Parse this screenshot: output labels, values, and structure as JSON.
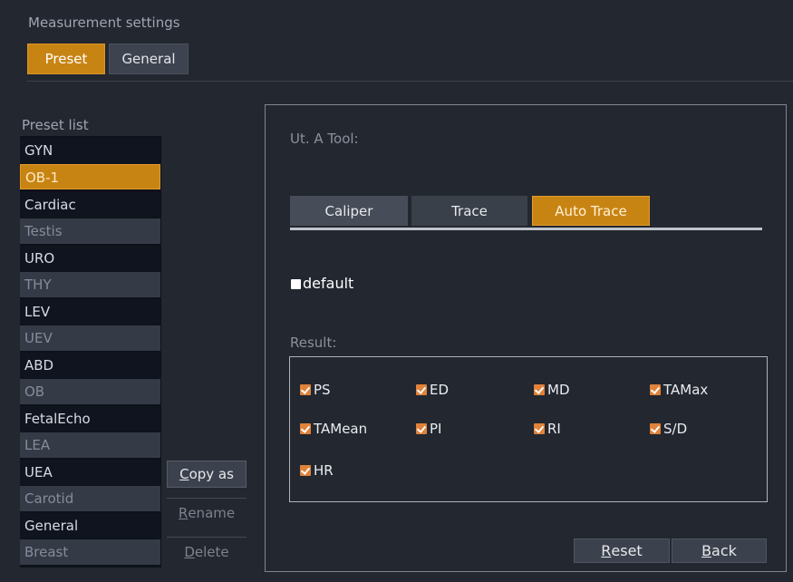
{
  "window": {
    "title": "Measurement settings"
  },
  "tabs": [
    {
      "label": "Preset",
      "active": true
    },
    {
      "label": "General",
      "active": false
    }
  ],
  "preset_list": {
    "label": "Preset list",
    "items": [
      "GYN",
      "OB-1",
      "Cardiac",
      "Testis",
      "URO",
      "THY",
      "LEV",
      "UEV",
      "ABD",
      "OB",
      "FetalEcho",
      "LEA",
      "UEA",
      "Carotid",
      "General",
      "Breast"
    ],
    "selected": "OB-1"
  },
  "list_actions": {
    "copy_as_u": "C",
    "copy_as_rest": "opy as",
    "rename_u": "R",
    "rename_rest": "ename",
    "delete_u": "D",
    "delete_rest": "elete"
  },
  "tool": {
    "label": "Ut. A Tool:",
    "tabs": [
      {
        "label": "Caliper",
        "active": false
      },
      {
        "label": "Trace",
        "active": false
      },
      {
        "label": "Auto Trace",
        "active": true
      }
    ]
  },
  "default_option": {
    "label": "default",
    "checked": false
  },
  "result": {
    "label": "Result:",
    "items": [
      {
        "label": "PS",
        "checked": true
      },
      {
        "label": "ED",
        "checked": true
      },
      {
        "label": "MD",
        "checked": true
      },
      {
        "label": "TAMax",
        "checked": true
      },
      {
        "label": "TAMean",
        "checked": true
      },
      {
        "label": "PI",
        "checked": true
      },
      {
        "label": "RI",
        "checked": true
      },
      {
        "label": "S/D",
        "checked": true
      },
      {
        "label": "HR",
        "checked": true
      }
    ]
  },
  "footer": {
    "reset_u": "R",
    "reset_rest": "eset",
    "back_u": "B",
    "back_rest": "ack"
  },
  "colors": {
    "background": "#23272f",
    "accent": "#c88413",
    "checkbox": "#e0823a"
  }
}
